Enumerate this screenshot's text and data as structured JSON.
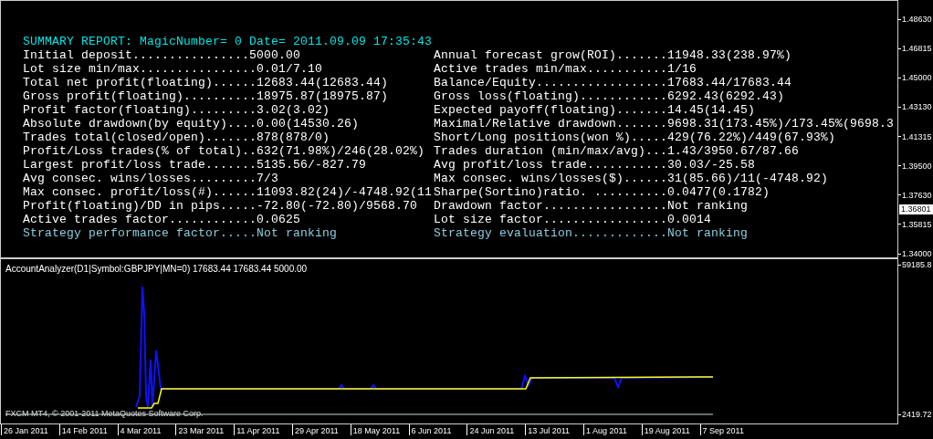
{
  "price_chart": {
    "report": {
      "title": "SUMMARY REPORT: MagicNumber= 0 Date= 2011.09.09 17:35:43",
      "left": [
        {
          "text": "Initial deposit................5000.00",
          "highlighted": false
        },
        {
          "text": "Lot size min/max................0.01/7.10",
          "highlighted": false
        },
        {
          "text": "Total net profit(floating)......12683.44(12683.44)",
          "highlighted": false
        },
        {
          "text": "Gross profit(floating)..........18975.87(18975.87)",
          "highlighted": false
        },
        {
          "text": "Profit factor(floating).........3.02(3.02)",
          "highlighted": false
        },
        {
          "text": "Absolute drawdown(by equity)....0.00(14530.26)",
          "highlighted": false
        },
        {
          "text": "Trades total(closed/open).......878(878/0)",
          "highlighted": false
        },
        {
          "text": "Profit/Loss trades(% of total)..632(71.98%)/246(28.02%)",
          "highlighted": false
        },
        {
          "text": "Largest profit/loss trade.......5135.56/-827.79",
          "highlighted": false
        },
        {
          "text": "Avg consec. wins/losses.........7/3",
          "highlighted": false
        },
        {
          "text": "Max consec. profit/loss(#)......11093.82(24)/-4748.92(11",
          "highlighted": false
        },
        {
          "text": "Profit(floating)/DD in pips.....-72.80(-72.80)/9568.70",
          "highlighted": false
        },
        {
          "text": "Active trades factor............0.0625",
          "highlighted": false
        },
        {
          "text": "Strategy performance factor.....Not ranking",
          "highlighted": true
        }
      ],
      "right": [
        {
          "text": "Annual forecast grow(ROI).......11948.33(238.97%)",
          "highlighted": false
        },
        {
          "text": "Active trades min/max...........1/16",
          "highlighted": false
        },
        {
          "text": "Balance/Equity..................17683.44/17683.44",
          "highlighted": false
        },
        {
          "text": "Gross loss(floating)............6292.43(6292.43)",
          "highlighted": false
        },
        {
          "text": "Expected payoff(floating).......14.45(14.45)",
          "highlighted": false
        },
        {
          "text": "Maximal/Relative drawdown.......9698.31(173.45%)/173.45%(9698.3",
          "highlighted": false
        },
        {
          "text": "Short/Long positions(won %).....429(76.22%)/449(67.93%)",
          "highlighted": false
        },
        {
          "text": "Trades duration (min/max/avg)...1.43/3950.67/87.66",
          "highlighted": false
        },
        {
          "text": "Avg profit/loss trade...........30.03/-25.58",
          "highlighted": false
        },
        {
          "text": "Max consec. wins/losses($)......31(85.66)/11(-4748.92)",
          "highlighted": false
        },
        {
          "text": "Sharpe(Sortino)ratio. ..........0.0477(0.1782)",
          "highlighted": false
        },
        {
          "text": "Drawdown factor.................Not ranking",
          "highlighted": false
        },
        {
          "text": "Lot size factor.................0.0014",
          "highlighted": false
        },
        {
          "text": "Strategy evaluation.............Not ranking",
          "highlighted": true
        }
      ]
    },
    "price_axis": [
      "1.48630",
      "1.46815",
      "1.45000",
      "1.43130",
      "1.41315",
      "1.39500",
      "1.37630",
      "1.35815",
      "1.34000"
    ],
    "current_price": "1.36801"
  },
  "indicator": {
    "label": "AccountAnalyzer(D1|Symbol:GBPJPY|MN=0) 17683.44 17683.44 5000.00",
    "axis": [
      "59185.8",
      "2419.72"
    ],
    "copyright": "FXCM MT4, © 2001-2011 MetaQuotes Software Corp."
  },
  "time_axis": [
    "26 Jan 2011",
    "14 Feb 2011",
    "4 Mar 2011",
    "23 Mar 2011",
    "11 Apr 2011",
    "29 Apr 2011",
    "18 May 2011",
    "6 Jun 2011",
    "24 Jun 2011",
    "13 Jul 2011",
    "1 Aug 2011",
    "19 Aug 2011",
    "7 Sep 2011"
  ]
}
